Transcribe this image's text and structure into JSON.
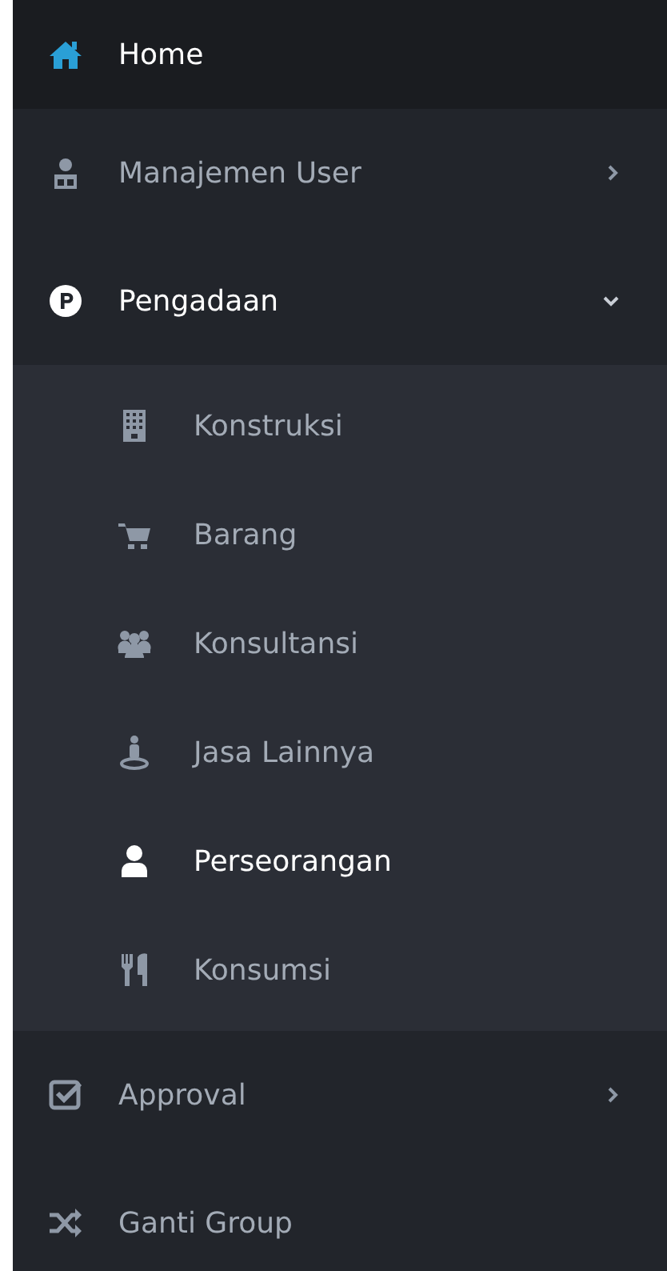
{
  "sidebar": {
    "items": [
      {
        "label": "Home",
        "kind": "link",
        "active": true
      },
      {
        "label": "Manajemen User",
        "kind": "submenu",
        "active": false,
        "expanded": false
      },
      {
        "label": "Pengadaan",
        "kind": "submenu",
        "active": false,
        "expanded": true,
        "children": [
          {
            "label": "Konstruksi",
            "selected": false
          },
          {
            "label": "Barang",
            "selected": false
          },
          {
            "label": "Konsultansi",
            "selected": false
          },
          {
            "label": "Jasa Lainnya",
            "selected": false
          },
          {
            "label": "Perseorangan",
            "selected": true
          },
          {
            "label": "Konsumsi",
            "selected": false
          }
        ]
      },
      {
        "label": "Approval",
        "kind": "submenu",
        "active": false,
        "expanded": false
      },
      {
        "label": "Ganti Group",
        "kind": "link",
        "active": false
      }
    ]
  }
}
